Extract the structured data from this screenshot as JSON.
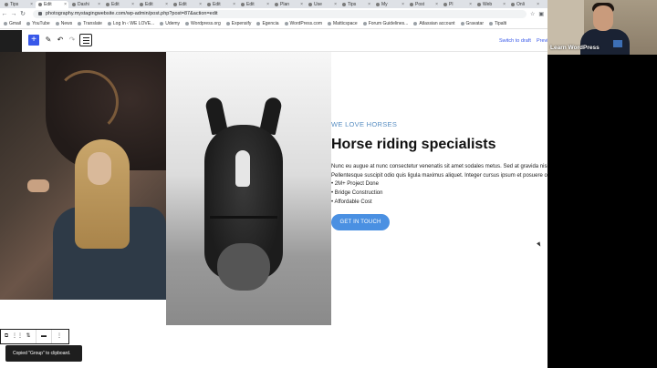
{
  "browser": {
    "tabs": [
      "Tips",
      "Edit",
      "Dashi",
      "Edit",
      "Edit",
      "Edit",
      "Edit",
      "Edit",
      "Plan",
      "Use",
      "Tips",
      "My",
      "Post",
      "Pl",
      "Web",
      "Onli"
    ],
    "active_tab_index": 1,
    "url": "photography.mystagingwebsite.com/wp-admin/post.php?post=87&action=edit",
    "bookmarks": [
      "Gmail",
      "YouTube",
      "News",
      "Translate",
      "Log In ‹ WE LOVE...",
      "Udemy",
      "Wordpress.org",
      "Expensify",
      "Egencia",
      "WordPress.com",
      "Matticspace",
      "Forum Guidelines...",
      "Atlassian account",
      "Gravatar",
      "Tipalti"
    ]
  },
  "editor": {
    "switch_to_draft": "Switch to draft",
    "preview": "Previ",
    "add_block": "+",
    "snackbar": "Copied \"Group\" to clipboard."
  },
  "content": {
    "kicker": "WE LOVE HORSES",
    "headline": "Horse riding specialists",
    "body": "Nunc eu augue at nunc consectetur venenatis sit amet sodales metus. Sed at gravida nisi, mattis lacinia ipsum. Pellentesque suscipit odio quis ligula maximus aliquet. Integer cursus ipsum et posuere ornare.",
    "bullets": [
      "2M+ Project Done",
      "Bridge Construction",
      "Affordable Cost"
    ],
    "cta": "GET IN TOUCH"
  },
  "webcam": {
    "caption": "Learn WordPress"
  },
  "colors": {
    "accent": "#3858e9",
    "button": "#4a90e2",
    "kicker": "#5a8fc2"
  }
}
